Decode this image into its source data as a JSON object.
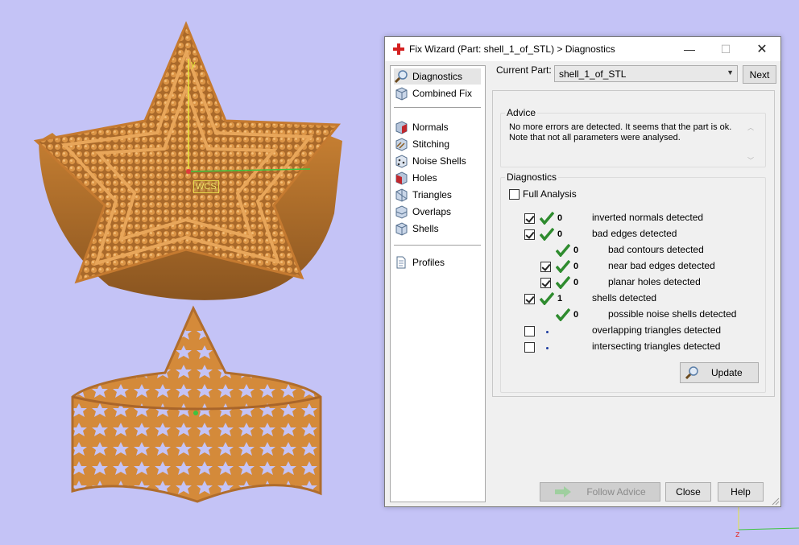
{
  "window": {
    "title": "Fix Wizard (Part: shell_1_of_STL) > Diagnostics",
    "controls": {
      "minimize": "—",
      "maximize": "☐",
      "close": "✕"
    }
  },
  "nav": {
    "items": [
      {
        "label": "Diagnostics",
        "icon": "magnifier-icon",
        "selected": true
      },
      {
        "label": "Combined Fix",
        "icon": "cube-icon"
      },
      {
        "label": "Normals",
        "icon": "cube-red-face-icon"
      },
      {
        "label": "Stitching",
        "icon": "stitch-icon"
      },
      {
        "label": "Noise Shells",
        "icon": "dice-icon"
      },
      {
        "label": "Holes",
        "icon": "cube-red-face-icon"
      },
      {
        "label": "Triangles",
        "icon": "triangle-cube-icon"
      },
      {
        "label": "Overlaps",
        "icon": "overlap-icon"
      },
      {
        "label": "Shells",
        "icon": "cube-icon"
      },
      {
        "label": "Profiles",
        "icon": "document-icon"
      }
    ]
  },
  "current_part": {
    "label": "Current Part:",
    "value": "shell_1_of_STL",
    "next_label": "Next"
  },
  "advice": {
    "title": "Advice",
    "line1": "No more errors are detected. It seems that the part is ok.",
    "line2": "Note that not all parameters were analysed."
  },
  "diagnostics": {
    "title": "Diagnostics",
    "full_analysis_label": "Full Analysis",
    "full_analysis_checked": false,
    "rows": [
      {
        "checked": true,
        "status": "ok",
        "count": "0",
        "label": "inverted normals detected",
        "indent": 0
      },
      {
        "checked": true,
        "status": "ok",
        "count": "0",
        "label": "bad edges detected",
        "indent": 0
      },
      {
        "checked": null,
        "status": "ok",
        "count": "0",
        "label": "bad contours detected",
        "indent": 1
      },
      {
        "checked": true,
        "status": "ok",
        "count": "0",
        "label": "near bad edges detected",
        "indent": 1
      },
      {
        "checked": true,
        "status": "ok",
        "count": "0",
        "label": "planar holes detected",
        "indent": 1
      },
      {
        "checked": true,
        "status": "ok",
        "count": "1",
        "label": "shells detected",
        "indent": 0
      },
      {
        "checked": null,
        "status": "ok",
        "count": "0",
        "label": "possible noise shells detected",
        "indent": 1
      },
      {
        "checked": false,
        "status": "pending",
        "count": "",
        "label": "overlapping triangles detected",
        "indent": 0
      },
      {
        "checked": false,
        "status": "pending",
        "count": "",
        "label": "intersecting triangles detected",
        "indent": 0
      }
    ],
    "update_label": "Update"
  },
  "footer": {
    "follow_advice": "Follow Advice",
    "close": "Close",
    "help": "Help"
  },
  "viewport": {
    "wcs_label": "WCS",
    "axis_y": "y",
    "axis_z": "z"
  },
  "colors": {
    "background": "#c4c3f6",
    "model": "#d48a3a",
    "check_green": "#2e8b2e",
    "axis_y": "#e4e43a",
    "axis_x": "#3fc43f"
  }
}
